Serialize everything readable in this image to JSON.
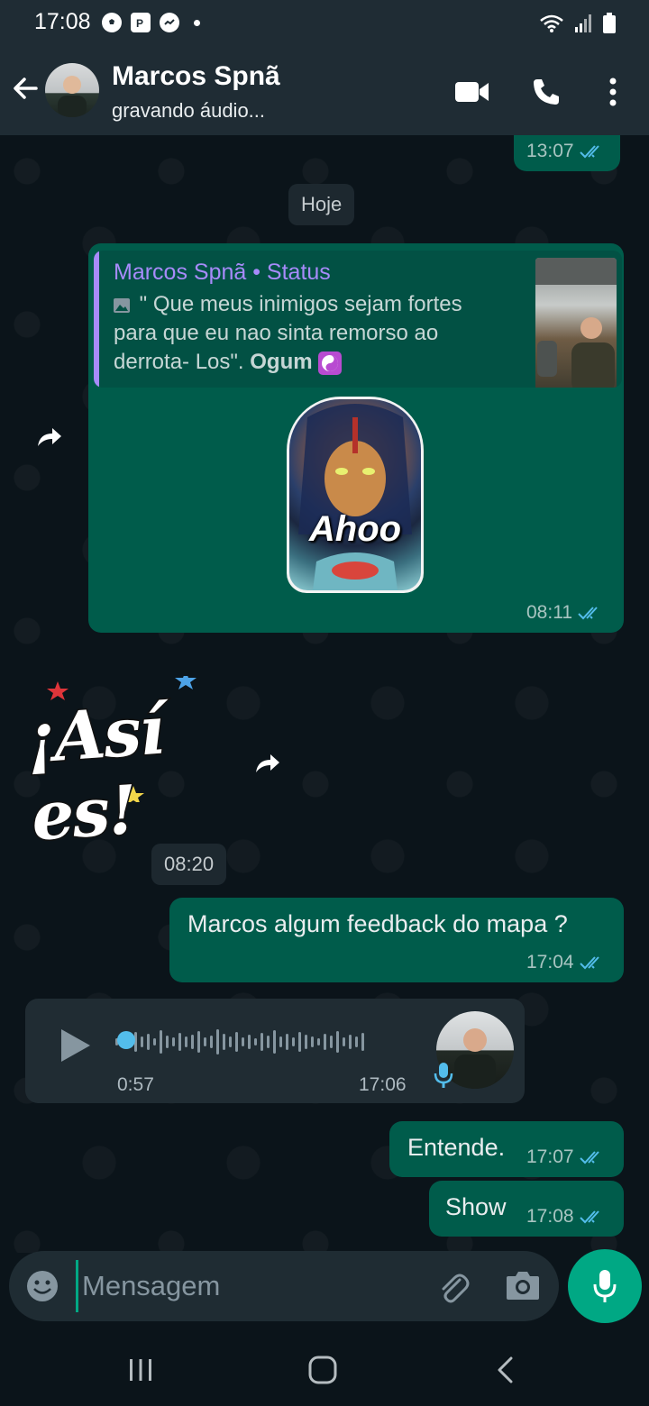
{
  "status_bar": {
    "time": "17:08"
  },
  "header": {
    "contact_name": "Marcos Spnã",
    "contact_status": "gravando áudio..."
  },
  "chat": {
    "prev_message_time": "13:07",
    "date_separator": "Hoje",
    "status_reply": {
      "author": "Marcos Spnã • Status",
      "quote_text": "\" Que meus inimigos sejam fortes para que eu nao sinta remorso ao derrota- Los\".",
      "quote_bold": "Ogum",
      "sticker_text": "Ahoo",
      "time": "08:11"
    },
    "incoming_sticker_text": "¡Así es!",
    "time_pill": "08:20",
    "messages": [
      {
        "text": "Marcos algum feedback do mapa ?",
        "time": "17:04"
      },
      {
        "text": "Entende.",
        "time": "17:07"
      },
      {
        "text": "Show",
        "time": "17:08"
      }
    ],
    "voice_message": {
      "duration": "0:57",
      "time": "17:06"
    }
  },
  "composer": {
    "placeholder": "Mensagem"
  },
  "colors": {
    "outgoing_bubble": "#005c4b",
    "incoming_bubble": "#202c33",
    "accent": "#00a884",
    "read_ticks": "#53bdeb",
    "status_author": "#a78bfa"
  }
}
